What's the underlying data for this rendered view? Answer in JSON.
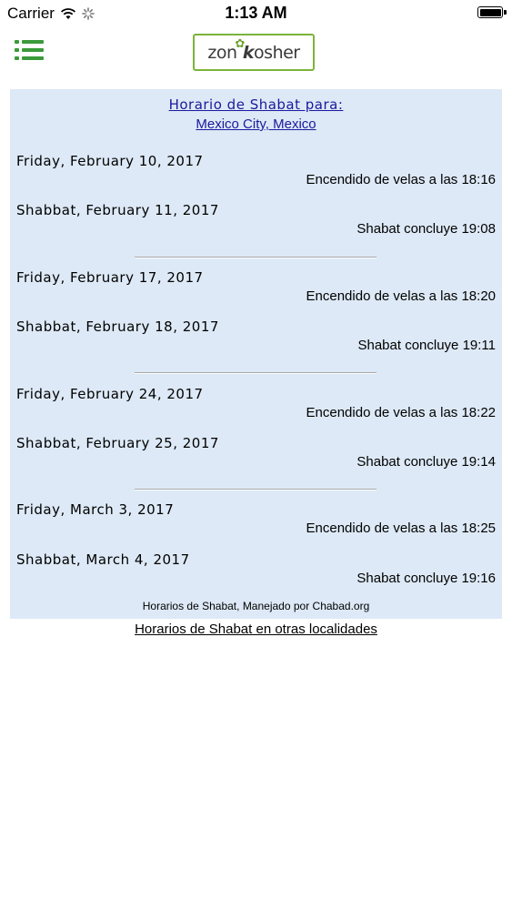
{
  "status_bar": {
    "carrier": "Carrier",
    "time": "1:13 AM"
  },
  "nav": {
    "logo_left": "zon",
    "logo_right": "osher"
  },
  "schedule": {
    "title": "Horario de Shabat para:",
    "location": "Mexico City, Mexico",
    "entries": [
      {
        "date": "Friday, February 10, 2017",
        "time": "Encendido de velas a las 18:16"
      },
      {
        "date": "Shabbat, February 11, 2017",
        "time": "Shabat concluye 19:08"
      },
      {
        "date": "Friday, February 17, 2017",
        "time": "Encendido de velas a las 18:20"
      },
      {
        "date": "Shabbat, February 18, 2017",
        "time": "Shabat concluye 19:11"
      },
      {
        "date": "Friday, February 24, 2017",
        "time": "Encendido de velas a las 18:22"
      },
      {
        "date": "Shabbat, February 25, 2017",
        "time": "Shabat concluye 19:14"
      },
      {
        "date": "Friday, March 3, 2017",
        "time": "Encendido de velas a las 18:25"
      },
      {
        "date": "Shabbat, March 4, 2017",
        "time": "Shabat concluye 19:16"
      }
    ],
    "credit": "Horarios de Shabat, Manejado por Chabad.org"
  },
  "other_locations_link": "Horarios de Shabat en otras localidades",
  "colors": {
    "panel_bg": "#dde9f6",
    "link_blue": "#1a1a9e",
    "menu_green": "#3a9a3a",
    "logo_green": "#7bb43a"
  }
}
